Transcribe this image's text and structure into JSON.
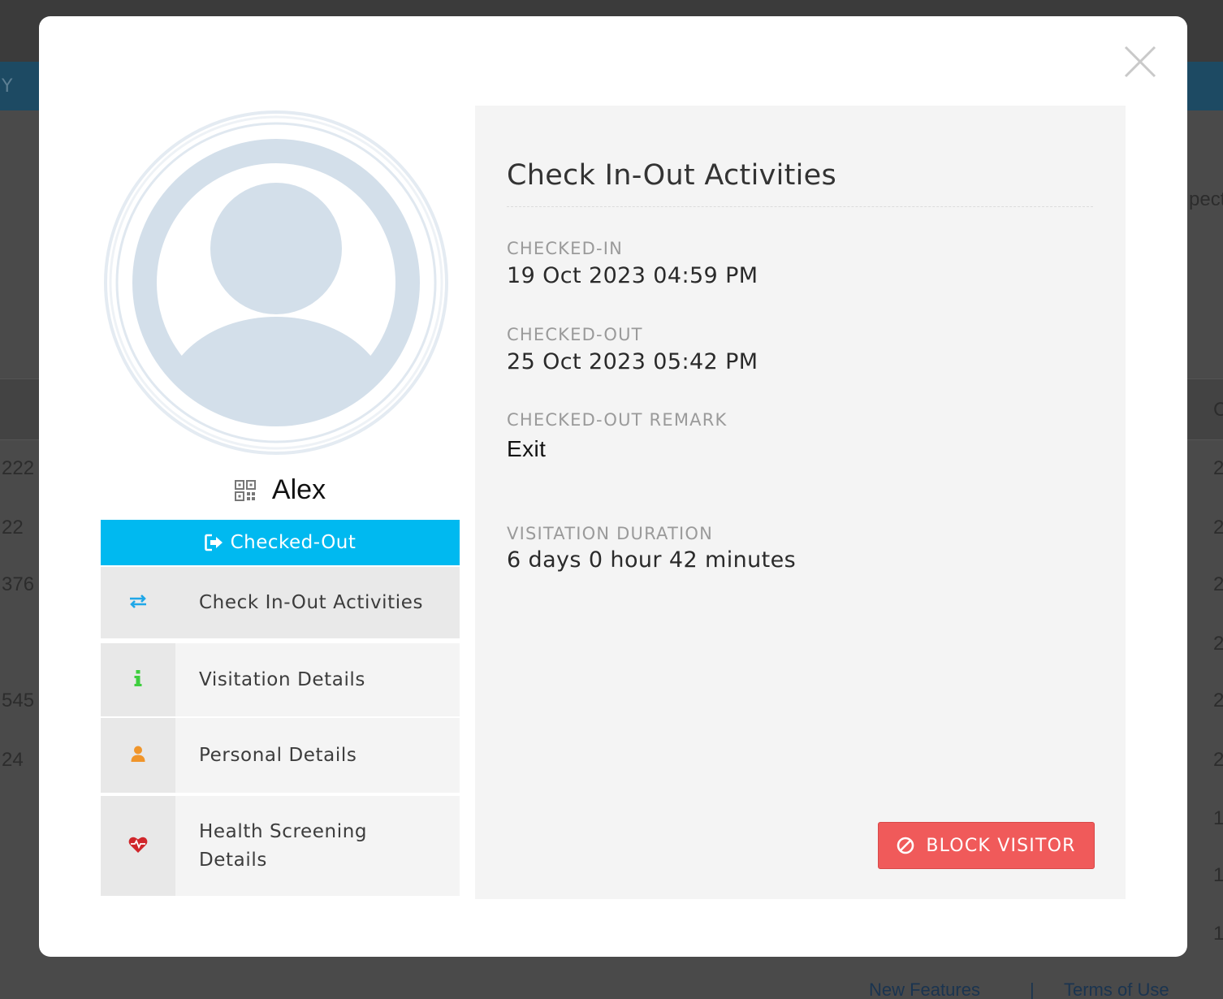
{
  "background": {
    "header_text": "Y",
    "side_text": "pect",
    "left_cells": [
      "222",
      "22",
      "376",
      "545",
      "24"
    ],
    "right_cells": [
      "2",
      "2",
      "2",
      "2",
      "2",
      "2",
      "1",
      "1",
      "1"
    ],
    "right_header": "C",
    "footer_links": [
      "New Features",
      "|",
      "Terms of Use"
    ]
  },
  "visitor": {
    "name": "Alex",
    "status": "Checked-Out"
  },
  "menu": [
    {
      "label": "Check In-Out Activities",
      "icon": "exchange-icon"
    },
    {
      "label": "Visitation Details",
      "icon": "info-icon"
    },
    {
      "label": "Personal Details",
      "icon": "user-icon"
    },
    {
      "label": "Health Screening Details",
      "icon": "heartbeat-icon"
    }
  ],
  "panel": {
    "title": "Check In-Out Activities",
    "fields": [
      {
        "label": "CHECKED-IN",
        "value": "19 Oct 2023 04:59 PM"
      },
      {
        "label": "CHECKED-OUT",
        "value": "25 Oct 2023 05:42 PM"
      },
      {
        "label": "CHECKED-OUT REMARK",
        "value": "Exit"
      },
      {
        "label": "VISITATION DURATION",
        "value": "6 days 0 hour 42 minutes"
      }
    ],
    "block_button": "BLOCK VISITOR"
  },
  "colors": {
    "status_bar": "#00b9f0",
    "block_button": "#f05a5a",
    "exchange_icon": "#1fa7e8",
    "info_icon": "#3fce3f",
    "user_icon": "#f0952a",
    "heartbeat_icon": "#d0262b",
    "avatar": "#d3dfea"
  }
}
